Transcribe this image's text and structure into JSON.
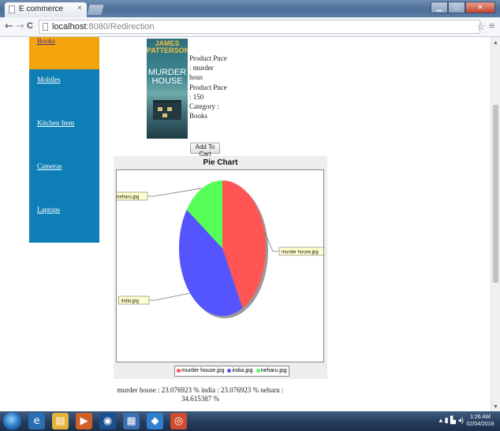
{
  "browser": {
    "tab_title": "E commerce",
    "tab_close": "×",
    "url_host": "localhost",
    "url_path": ":8080/Redirection",
    "back": "←",
    "forward": "→",
    "reload": "C",
    "star": "☆",
    "menu": "≡",
    "minimize": "▁",
    "maximize": "□",
    "close": "✕"
  },
  "sidebar": {
    "items": [
      {
        "label": "Books",
        "active": true
      },
      {
        "label": "Mobiles",
        "active": false
      },
      {
        "label": "Kitchen Item",
        "active": false
      },
      {
        "label": "Cameras",
        "active": false
      },
      {
        "label": "Laptops",
        "active": false
      }
    ]
  },
  "product": {
    "cover_author": "JAMES PATTERSON",
    "cover_title": "MURDER HOUSE",
    "line1": "Product Pnce",
    "line2": ": murder",
    "line3": "hous",
    "line4": "Product Pnce",
    "line5": ": 150",
    "line6": "Category :",
    "line7": "Books",
    "add_to_cart": "Add To Cart"
  },
  "chart_data": {
    "type": "pie",
    "title": "Pie Chart",
    "slices": [
      {
        "label": "murder house.jpg",
        "value": 42.307692,
        "color": "#ff5555"
      },
      {
        "label": "india.jpg",
        "value": 42.307692,
        "color": "#5555ff"
      },
      {
        "label": "neharu.jpg",
        "value": 15.384616,
        "color": "#55ff55"
      }
    ],
    "legend": [
      "murder house.jpg",
      "india.jpg",
      "neharu.jpg"
    ],
    "legend_position": "bottom"
  },
  "stats": {
    "line1": "murder house : 23.076923 % india : 23.076923 % neharu :",
    "line2": "34.615387 %"
  },
  "taskbar": {
    "time": "1:26 AM",
    "date": "02/04/2016"
  }
}
